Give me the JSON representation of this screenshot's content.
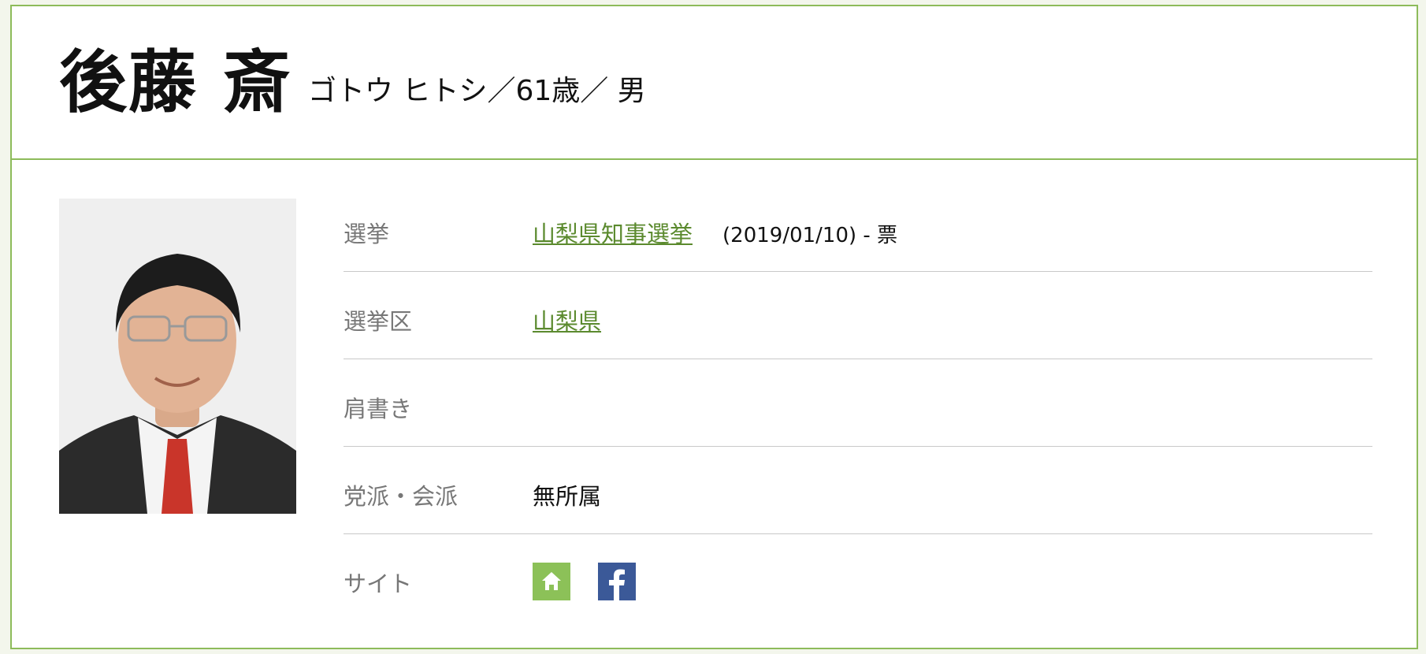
{
  "candidate": {
    "name": "後藤 斎",
    "kana_age_gender": "ゴトウ ヒトシ／61歳／ 男"
  },
  "details": [
    {
      "label": "選挙",
      "link_text": "山梨県知事選挙",
      "meta": "(2019/01/10) - 票"
    },
    {
      "label": "選挙区",
      "link_text": "山梨県"
    },
    {
      "label": "肩書き"
    },
    {
      "label": "党派・会派",
      "value": "無所属"
    },
    {
      "label": "サイト",
      "sites": [
        "home-icon",
        "facebook-icon"
      ]
    }
  ],
  "colors": {
    "accent": "#8dbb5a",
    "link": "#5b8a2e",
    "home": "#8cc158",
    "facebook": "#3b5998"
  }
}
